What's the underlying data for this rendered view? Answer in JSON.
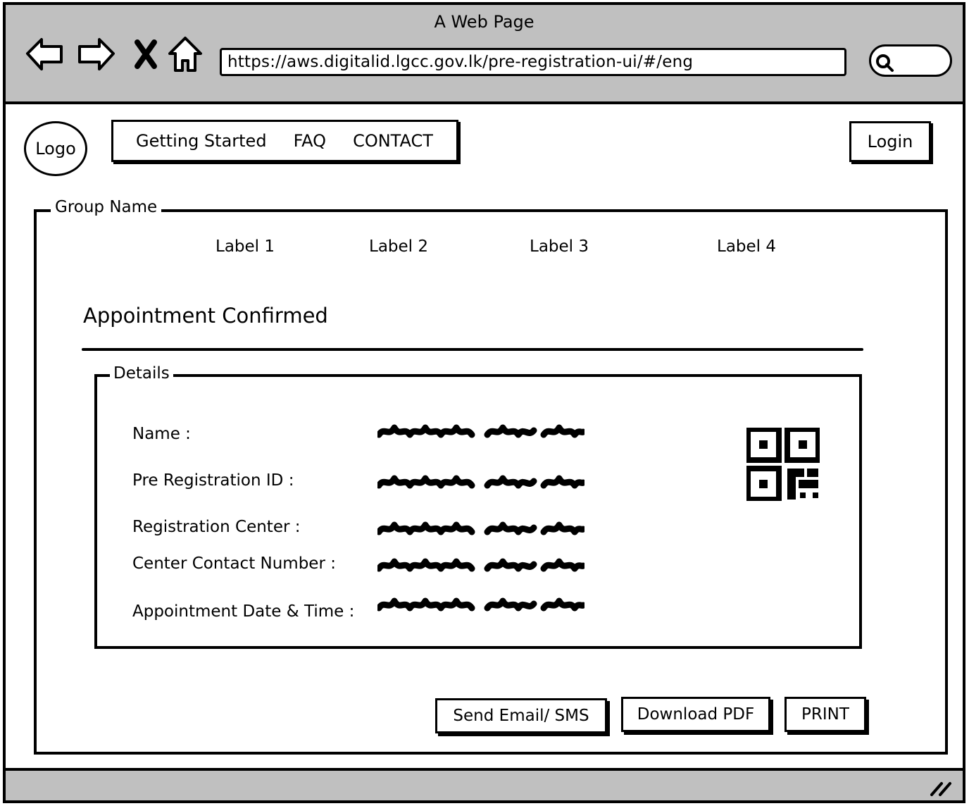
{
  "window": {
    "title": "A Web Page"
  },
  "browser": {
    "url": "https://aws.digitalid.lgcc.gov.lk/pre-registration-ui/#/eng",
    "icons": [
      "back-arrow-icon",
      "forward-arrow-icon",
      "close-x-icon",
      "home-icon",
      "search-icon",
      "resize-grip-icon"
    ]
  },
  "header": {
    "logo_label": "Logo",
    "menu": [
      "Getting Started",
      "FAQ",
      "CONTACT"
    ],
    "login_label": "Login"
  },
  "group": {
    "legend": "Group Name",
    "steps": [
      "Label 1",
      "Label 2",
      "Label 3",
      "Label 4"
    ],
    "title": "Appointment Confirmed"
  },
  "details": {
    "legend": "Details",
    "rows": [
      {
        "label": "Name :"
      },
      {
        "label": "Pre Registration ID :"
      },
      {
        "label": "Registration Center :"
      },
      {
        "label": "Center Contact Number :"
      },
      {
        "label": "Appointment Date & Time :"
      }
    ],
    "qr_icon": "qr-code-icon"
  },
  "actions": {
    "send": "Send Email/ SMS",
    "download": "Download PDF",
    "print": "PRINT"
  }
}
